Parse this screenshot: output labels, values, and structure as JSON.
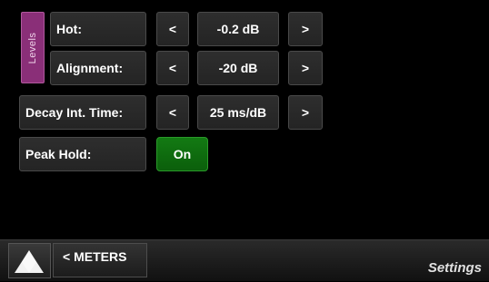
{
  "levels": {
    "label": "Levels"
  },
  "rows": [
    {
      "label": "Hot:",
      "dec": "<",
      "value": "-0.2 dB",
      "inc": ">"
    },
    {
      "label": "Alignment:",
      "dec": "<",
      "value": "-20 dB",
      "inc": ">"
    },
    {
      "label": "Decay Int. Time:",
      "dec": "<",
      "value": "25 ms/dB",
      "inc": ">"
    }
  ],
  "peak_hold": {
    "label": "Peak Hold:",
    "value": "On"
  },
  "footer": {
    "meters_label": "< METERS",
    "page_title": "Settings"
  },
  "icons": {
    "logo": "triangle-logo-icon"
  },
  "colors": {
    "levels_tab": "#8a2f78",
    "on_button": "#137a13",
    "background": "#000000"
  }
}
